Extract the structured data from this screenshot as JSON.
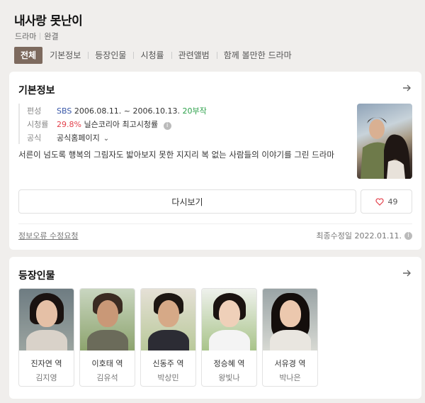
{
  "header": {
    "title": "내사랑 못난이",
    "genre": "드라마",
    "status": "완결",
    "tabs": [
      "전체",
      "기본정보",
      "등장인물",
      "시청률",
      "관련앨범",
      "함께 볼만한 드라마"
    ]
  },
  "basic_info": {
    "section_title": "기본정보",
    "broadcast_label": "편성",
    "channel": "SBS",
    "period": "2006.08.11. ~ 2006.10.13.",
    "episodes": "20부작",
    "rating_label": "시청률",
    "rating": "29.8%",
    "rating_source": "닐슨코리아 최고시청률",
    "official_label": "공식",
    "official_link": "공식홈페이지",
    "description": "서른이 넘도록 행복의 그림자도 밟아보지 못한 지지리 복 없는 사람들의 이야기를 그린 드라마",
    "replay_label": "다시보기",
    "likes": "49",
    "report_label": "정보오류 수정요청",
    "updated": "최종수정일 2022.01.11."
  },
  "cast_section": {
    "section_title": "등장인물",
    "people": [
      {
        "role": "진자연 역",
        "actor": "김지영"
      },
      {
        "role": "이호태 역",
        "actor": "김유석"
      },
      {
        "role": "신동주 역",
        "actor": "박상민"
      },
      {
        "role": "정승혜 역",
        "actor": "왕빛나"
      },
      {
        "role": "서유경 역",
        "actor": "박나은"
      }
    ]
  },
  "colors": {
    "active_tab": "#7d6a5e",
    "link_blue": "#3857a8",
    "episodes_green": "#2ca14a",
    "rating_red": "#e3404b"
  },
  "icons": [
    "arrow-right-icon",
    "info-icon",
    "chevron-down-icon",
    "heart-icon"
  ]
}
